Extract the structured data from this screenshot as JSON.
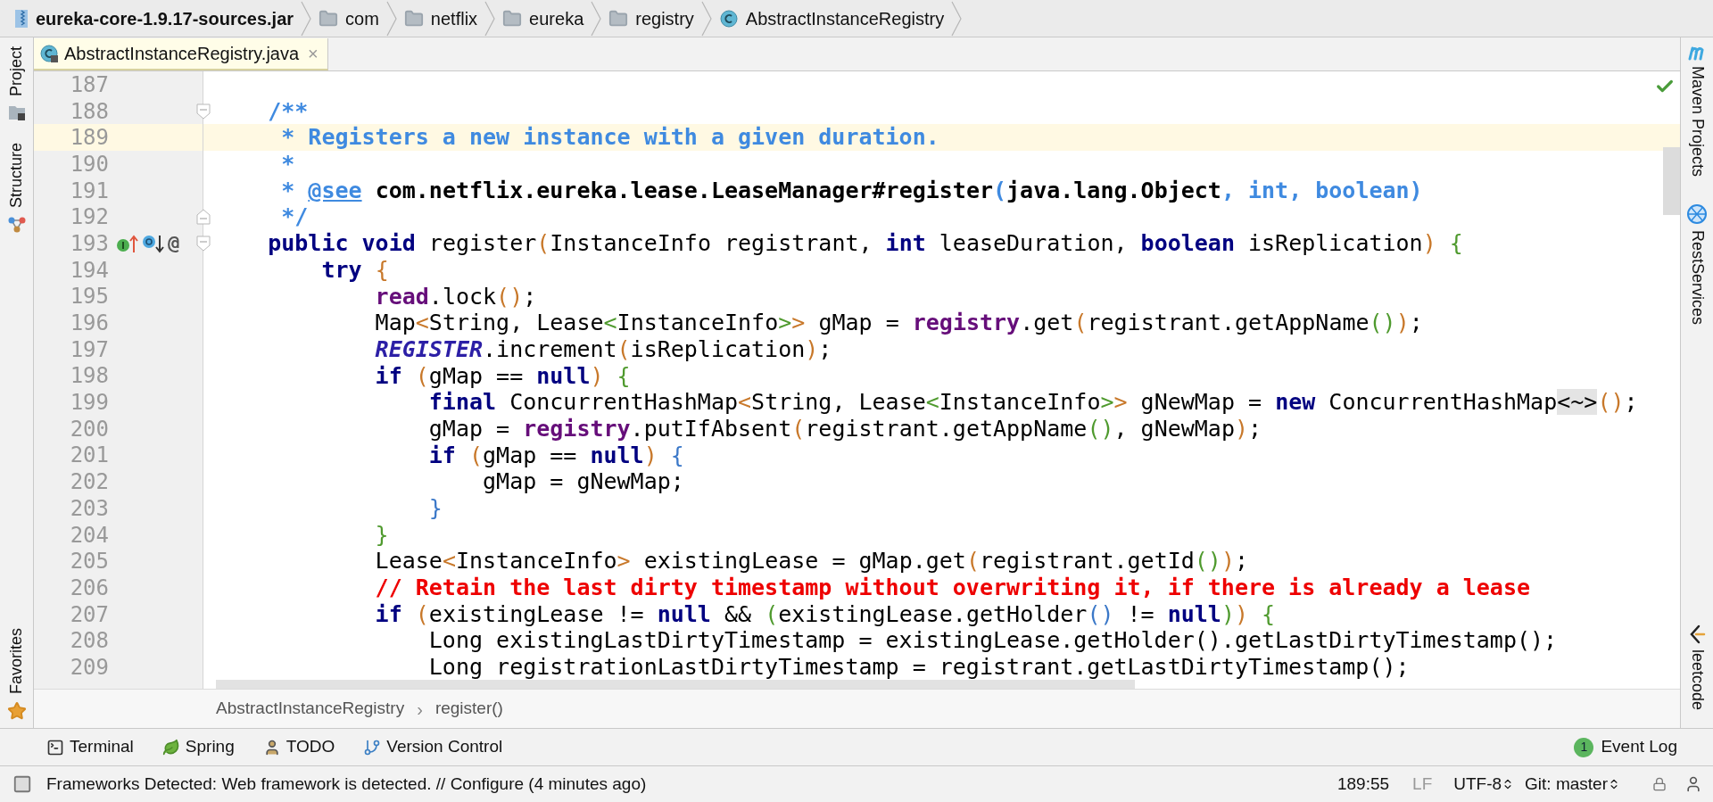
{
  "breadcrumbs": [
    {
      "kind": "jar",
      "label": "eureka-core-1.9.17-sources.jar"
    },
    {
      "kind": "folder",
      "label": "com"
    },
    {
      "kind": "folder",
      "label": "netflix"
    },
    {
      "kind": "folder",
      "label": "eureka"
    },
    {
      "kind": "folder",
      "label": "registry"
    },
    {
      "kind": "class",
      "label": "AbstractInstanceRegistry"
    }
  ],
  "editor_tabs": [
    {
      "label": "AbstractInstanceRegistry.java",
      "selected": true,
      "close": "×"
    }
  ],
  "left_tool_windows": [
    {
      "kind": "project",
      "label": "Project"
    },
    {
      "kind": "structure",
      "label": "Structure"
    },
    {
      "kind": "favorites",
      "label": "Favorites"
    }
  ],
  "right_tool_windows": [
    {
      "kind": "maven",
      "label": "Maven Projects"
    },
    {
      "kind": "rest",
      "label": "RestServices"
    },
    {
      "kind": "leetcode",
      "label": "leetcode"
    }
  ],
  "editor": {
    "analysis_ok": true,
    "lines": [
      {
        "number": "187",
        "current": false
      },
      {
        "number": "188",
        "current": false,
        "fold_marker": {
          "kind": "start"
        },
        "tokens": [
          {
            "kind": "doc",
            "text": "    /**"
          }
        ]
      },
      {
        "number": "189",
        "current": true,
        "tokens": [
          {
            "kind": "doc",
            "text": "     * Registers a new instance with a given duration."
          }
        ]
      },
      {
        "number": "190",
        "current": false,
        "tokens": [
          {
            "kind": "doc",
            "text": "     *"
          }
        ]
      },
      {
        "number": "191",
        "current": false,
        "tokens": [
          {
            "kind": "doc",
            "text": "     * "
          },
          {
            "kind": "doctag",
            "text": "@see"
          },
          {
            "kind": "docref",
            "text": " com.netflix.eureka.lease.LeaseManager#register"
          },
          {
            "kind": "doc",
            "text": "("
          },
          {
            "kind": "docref",
            "text": "java.lang.Object"
          },
          {
            "kind": "doc",
            "text": ", int, boolean)"
          }
        ]
      },
      {
        "number": "192",
        "current": false,
        "fold_marker": {
          "kind": "end"
        },
        "tokens": [
          {
            "kind": "doc",
            "text": "     */"
          }
        ]
      },
      {
        "number": "193",
        "current": false,
        "fold_marker": {
          "kind": "start"
        },
        "markers": [
          {
            "kind": "implements"
          },
          {
            "kind": "overridden"
          },
          {
            "kind": "annotation",
            "text": "@"
          }
        ],
        "tokens": [
          {
            "kind": "keyword",
            "text": "    public void"
          },
          {
            "kind": "text",
            "text": " register"
          },
          {
            "kind": "paren1",
            "text": "("
          },
          {
            "kind": "text",
            "text": "InstanceInfo registrant, "
          },
          {
            "kind": "keyword",
            "text": "int"
          },
          {
            "kind": "text",
            "text": " leaseDuration, "
          },
          {
            "kind": "keyword",
            "text": "boolean"
          },
          {
            "kind": "text",
            "text": " isReplication"
          },
          {
            "kind": "paren1",
            "text": ")"
          },
          {
            "kind": "paren2",
            "text": " {"
          }
        ]
      },
      {
        "number": "194",
        "current": false,
        "tokens": [
          {
            "kind": "keyword",
            "text": "        try"
          },
          {
            "kind": "paren1",
            "text": " {"
          }
        ]
      },
      {
        "number": "195",
        "current": false,
        "tokens": [
          {
            "kind": "field",
            "text": "            read"
          },
          {
            "kind": "text",
            "text": ".lock"
          },
          {
            "kind": "paren1",
            "text": "()"
          },
          {
            "kind": "text",
            "text": ";"
          }
        ]
      },
      {
        "number": "196",
        "current": false,
        "tokens": [
          {
            "kind": "text",
            "text": "            Map"
          },
          {
            "kind": "paren1",
            "text": "<"
          },
          {
            "kind": "text",
            "text": "String, Lease"
          },
          {
            "kind": "paren2",
            "text": "<"
          },
          {
            "kind": "text",
            "text": "InstanceInfo"
          },
          {
            "kind": "paren2",
            "text": ">"
          },
          {
            "kind": "paren1",
            "text": ">"
          },
          {
            "kind": "text",
            "text": " gMap = "
          },
          {
            "kind": "field",
            "text": "registry"
          },
          {
            "kind": "text",
            "text": ".get"
          },
          {
            "kind": "paren1",
            "text": "("
          },
          {
            "kind": "text",
            "text": "registrant.getAppName"
          },
          {
            "kind": "paren2",
            "text": "()"
          },
          {
            "kind": "paren1",
            "text": ")"
          },
          {
            "kind": "text",
            "text": ";"
          }
        ]
      },
      {
        "number": "197",
        "current": false,
        "tokens": [
          {
            "kind": "constant",
            "text": "            REGISTER"
          },
          {
            "kind": "text",
            "text": ".increment"
          },
          {
            "kind": "paren1",
            "text": "("
          },
          {
            "kind": "text",
            "text": "isReplication"
          },
          {
            "kind": "paren1",
            "text": ")"
          },
          {
            "kind": "text",
            "text": ";"
          }
        ]
      },
      {
        "number": "198",
        "current": false,
        "tokens": [
          {
            "kind": "keyword",
            "text": "            if"
          },
          {
            "kind": "paren1",
            "text": " ("
          },
          {
            "kind": "text",
            "text": "gMap == "
          },
          {
            "kind": "keyword",
            "text": "null"
          },
          {
            "kind": "paren1",
            "text": ")"
          },
          {
            "kind": "paren2",
            "text": " {"
          }
        ]
      },
      {
        "number": "199",
        "current": false,
        "tokens": [
          {
            "kind": "keyword",
            "text": "                final"
          },
          {
            "kind": "text",
            "text": " ConcurrentHashMap"
          },
          {
            "kind": "paren1",
            "text": "<"
          },
          {
            "kind": "text",
            "text": "String, Lease"
          },
          {
            "kind": "paren2",
            "text": "<"
          },
          {
            "kind": "text",
            "text": "InstanceInfo"
          },
          {
            "kind": "paren2",
            "text": ">"
          },
          {
            "kind": "paren1",
            "text": ">"
          },
          {
            "kind": "text",
            "text": " gNewMap = "
          },
          {
            "kind": "keyword",
            "text": "new"
          },
          {
            "kind": "text",
            "text": " ConcurrentHashMap"
          },
          {
            "kind": "folded",
            "text": "<~>"
          },
          {
            "kind": "paren1",
            "text": "()"
          },
          {
            "kind": "text",
            "text": ";"
          }
        ]
      },
      {
        "number": "200",
        "current": false,
        "tokens": [
          {
            "kind": "text",
            "text": "                gMap = "
          },
          {
            "kind": "field",
            "text": "registry"
          },
          {
            "kind": "text",
            "text": ".putIfAbsent"
          },
          {
            "kind": "paren1",
            "text": "("
          },
          {
            "kind": "text",
            "text": "registrant.getAppName"
          },
          {
            "kind": "paren2",
            "text": "()"
          },
          {
            "kind": "text",
            "text": ", gNewMap"
          },
          {
            "kind": "paren1",
            "text": ")"
          },
          {
            "kind": "text",
            "text": ";"
          }
        ]
      },
      {
        "number": "201",
        "current": false,
        "tokens": [
          {
            "kind": "keyword",
            "text": "                if"
          },
          {
            "kind": "paren1",
            "text": " ("
          },
          {
            "kind": "text",
            "text": "gMap == "
          },
          {
            "kind": "keyword",
            "text": "null"
          },
          {
            "kind": "paren1",
            "text": ")"
          },
          {
            "kind": "paren3",
            "text": " {"
          }
        ]
      },
      {
        "number": "202",
        "current": false,
        "tokens": [
          {
            "kind": "text",
            "text": "                    gMap = gNewMap;"
          }
        ]
      },
      {
        "number": "203",
        "current": false,
        "tokens": [
          {
            "kind": "paren3",
            "text": "                }"
          }
        ]
      },
      {
        "number": "204",
        "current": false,
        "tokens": [
          {
            "kind": "paren2",
            "text": "            }"
          }
        ]
      },
      {
        "number": "205",
        "current": false,
        "tokens": [
          {
            "kind": "text",
            "text": "            Lease"
          },
          {
            "kind": "paren1",
            "text": "<"
          },
          {
            "kind": "text",
            "text": "InstanceInfo"
          },
          {
            "kind": "paren1",
            "text": ">"
          },
          {
            "kind": "text",
            "text": " existingLease = gMap.get"
          },
          {
            "kind": "paren1",
            "text": "("
          },
          {
            "kind": "text",
            "text": "registrant.getId"
          },
          {
            "kind": "paren2",
            "text": "()"
          },
          {
            "kind": "paren1",
            "text": ")"
          },
          {
            "kind": "text",
            "text": ";"
          }
        ]
      },
      {
        "number": "206",
        "current": false,
        "tokens": [
          {
            "kind": "comment",
            "text": "            // Retain the last dirty timestamp without overwriting it, if there is already a lease"
          }
        ]
      },
      {
        "number": "207",
        "current": false,
        "tokens": [
          {
            "kind": "keyword",
            "text": "            if"
          },
          {
            "kind": "paren1",
            "text": " ("
          },
          {
            "kind": "text",
            "text": "existingLease != "
          },
          {
            "kind": "keyword",
            "text": "null"
          },
          {
            "kind": "text",
            "text": " && "
          },
          {
            "kind": "paren2",
            "text": "("
          },
          {
            "kind": "text",
            "text": "existingLease.getHolder"
          },
          {
            "kind": "paren3",
            "text": "()"
          },
          {
            "kind": "text",
            "text": " != "
          },
          {
            "kind": "keyword",
            "text": "null"
          },
          {
            "kind": "paren2",
            "text": ")"
          },
          {
            "kind": "paren1",
            "text": ")"
          },
          {
            "kind": "paren2",
            "text": " {"
          }
        ]
      },
      {
        "number": "208",
        "current": false,
        "tokens": [
          {
            "kind": "text",
            "text": "                Long existingLastDirtyTimestamp = existingLease.getHolder().getLastDirtyTimestamp();"
          }
        ]
      },
      {
        "number": "209",
        "current": false,
        "tokens": [
          {
            "kind": "text",
            "text": "                Long registrationLastDirtyTimestamp = registrant.getLastDirtyTimestamp();"
          }
        ]
      }
    ]
  },
  "code_breadcrumbs": {
    "items": [
      "AbstractInstanceRegistry",
      "register()"
    ],
    "separator": "›"
  },
  "tool_buttons": [
    {
      "kind": "terminal",
      "label": "Terminal"
    },
    {
      "kind": "spring",
      "label": "Spring"
    },
    {
      "kind": "todo",
      "label": "TODO"
    },
    {
      "kind": "vcs",
      "label": "Version Control"
    }
  ],
  "event_log": {
    "count": "1",
    "label": "Event Log"
  },
  "status_bar": {
    "message": "Frameworks Detected: Web framework is detected. // Configure (4 minutes ago)",
    "position": "189:55",
    "line_separator": "LF",
    "encoding": "UTF-8",
    "vcs": "Git: master"
  }
}
